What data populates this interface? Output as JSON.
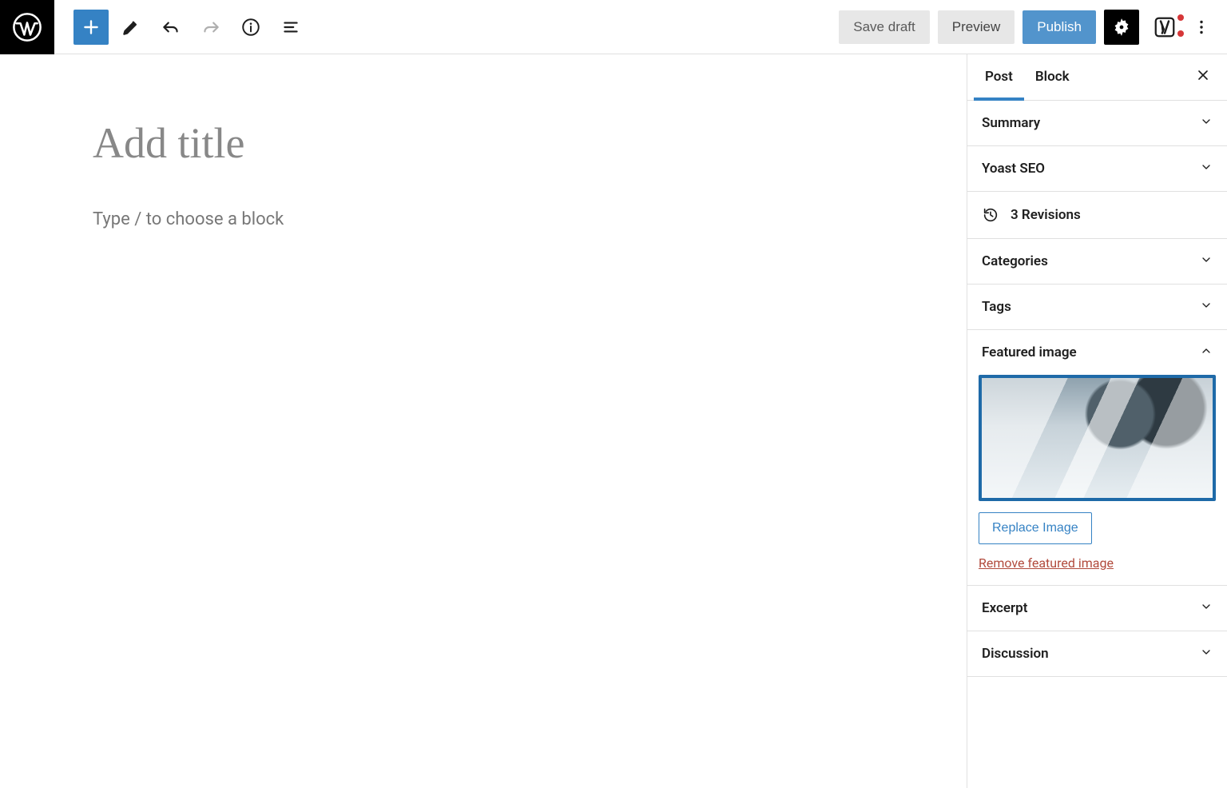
{
  "topbar": {
    "save_draft": "Save draft",
    "preview": "Preview",
    "publish": "Publish"
  },
  "editor": {
    "title_placeholder": "Add title",
    "body_prompt": "Type / to choose a block"
  },
  "sidebar": {
    "tabs": {
      "post": "Post",
      "block": "Block"
    },
    "panels": {
      "summary": "Summary",
      "yoast": "Yoast SEO",
      "revisions": "3 Revisions",
      "categories": "Categories",
      "tags": "Tags",
      "featured": "Featured image",
      "replace": "Replace Image",
      "remove": "Remove featured image",
      "excerpt": "Excerpt",
      "discussion": "Discussion"
    }
  },
  "icons": {
    "plus": "plus-icon",
    "pencil": "pencil-icon",
    "undo": "undo-icon",
    "redo": "redo-icon",
    "info": "info-icon",
    "list": "list-view-icon",
    "gear": "gear-icon",
    "yoast": "yoast-icon",
    "more": "more-icon",
    "history": "history-icon"
  }
}
